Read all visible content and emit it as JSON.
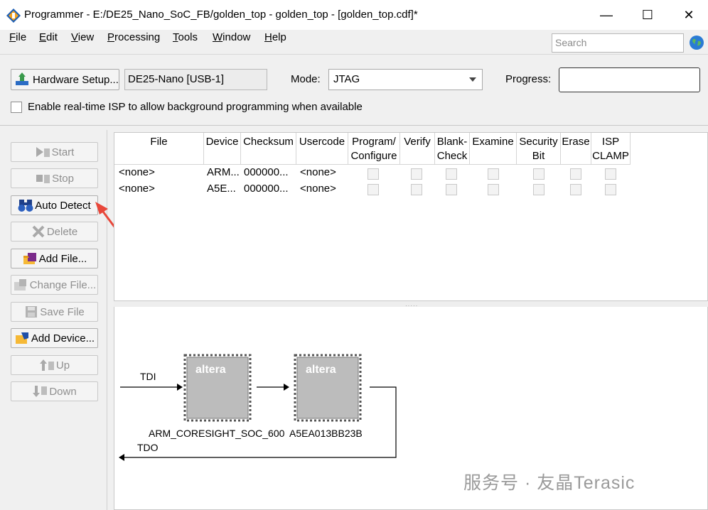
{
  "window": {
    "title": "Programmer - E:/DE25_Nano_SoC_FB/golden_top - golden_top - [golden_top.cdf]*",
    "controls": [
      "—",
      "☐",
      "✕"
    ]
  },
  "menu": [
    {
      "label": "File",
      "mnemonic": "F",
      "rest": "ile"
    },
    {
      "label": "Edit",
      "mnemonic": "E",
      "rest": "dit"
    },
    {
      "label": "View",
      "mnemonic": "V",
      "rest": "iew"
    },
    {
      "label": "Processing",
      "mnemonic": "P",
      "rest": "rocessing"
    },
    {
      "label": "Tools",
      "mnemonic": "T",
      "rest": "ools"
    },
    {
      "label": "Window",
      "mnemonic": "W",
      "rest": "indow"
    },
    {
      "label": "Help",
      "mnemonic": "H",
      "rest": "elp"
    }
  ],
  "search": {
    "placeholder": "Search"
  },
  "toolbar": {
    "hardware_setup_label": "Hardware Setup...",
    "hardware_value": "DE25-Nano [USB-1]",
    "mode_label": "Mode:",
    "mode_value": "JTAG",
    "progress_label": "Progress:",
    "progress_value": ""
  },
  "isp": {
    "label": "Enable real-time ISP to allow background programming when available",
    "checked": false
  },
  "side_buttons": [
    {
      "label": "Start",
      "icon": "start-icon",
      "enabled": false
    },
    {
      "label": "Stop",
      "icon": "stop-icon",
      "enabled": false
    },
    {
      "label": "Auto Detect",
      "icon": "binoculars-icon",
      "enabled": true
    },
    {
      "label": "Delete",
      "icon": "delete-x-icon",
      "enabled": false
    },
    {
      "label": "Add File...",
      "icon": "add-file-icon",
      "enabled": true
    },
    {
      "label": "Change File...",
      "icon": "change-file-icon",
      "enabled": false
    },
    {
      "label": "Save File",
      "icon": "save-icon",
      "enabled": false
    },
    {
      "label": "Add Device...",
      "icon": "add-device-icon",
      "enabled": true
    },
    {
      "label": "Up",
      "icon": "up-arrow-icon",
      "enabled": false
    },
    {
      "label": "Down",
      "icon": "down-arrow-icon",
      "enabled": false
    }
  ],
  "table": {
    "columns": [
      {
        "line1": "File",
        "line2": ""
      },
      {
        "line1": "Device",
        "line2": ""
      },
      {
        "line1": "Checksum",
        "line2": ""
      },
      {
        "line1": "Usercode",
        "line2": ""
      },
      {
        "line1": "Program/",
        "line2": "Configure"
      },
      {
        "line1": "Verify",
        "line2": ""
      },
      {
        "line1": "Blank-",
        "line2": "Check"
      },
      {
        "line1": "Examine",
        "line2": ""
      },
      {
        "line1": "Security",
        "line2": "Bit"
      },
      {
        "line1": "Erase",
        "line2": ""
      },
      {
        "line1": "ISP",
        "line2": "CLAMP"
      }
    ],
    "rows": [
      {
        "file": "<none>",
        "device": "ARM...",
        "checksum": "000000...",
        "usercode": "<none>"
      },
      {
        "file": "<none>",
        "device": "A5E...",
        "checksum": "000000...",
        "usercode": "<none>"
      }
    ]
  },
  "chain": {
    "tdi": "TDI",
    "tdo": "TDO",
    "devices": [
      {
        "logo": "altera",
        "name": "ARM_CORESIGHT_SOC_600"
      },
      {
        "logo": "altera",
        "name": "A5EA013BB23B"
      }
    ]
  },
  "colors": {
    "annotation_arrow": "#e8473a",
    "chip_fill": "#bcbcbc"
  },
  "watermark": "服务号 · 友晶Terasic"
}
